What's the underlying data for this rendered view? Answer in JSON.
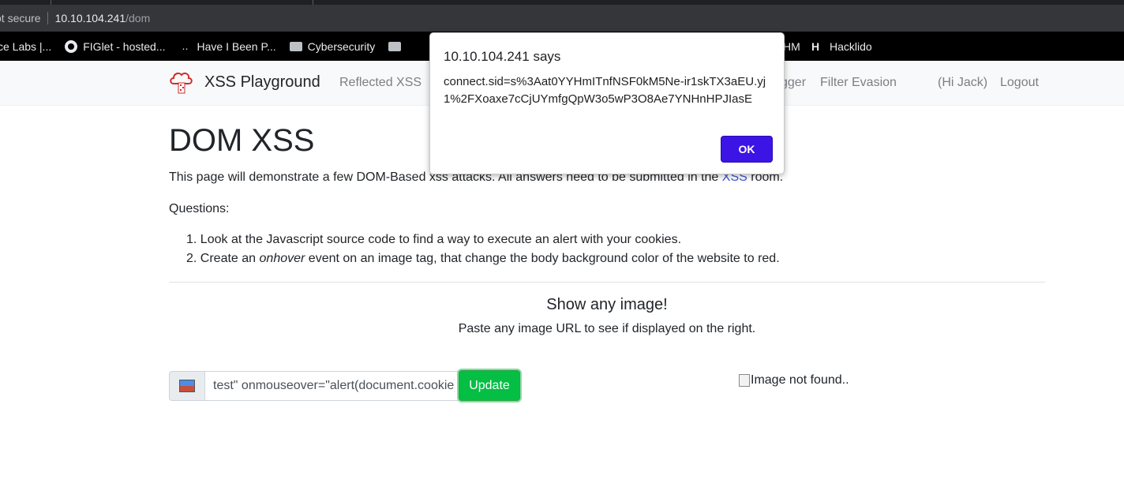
{
  "browser": {
    "security_label": "ot secure",
    "url_host": "10.10.104.241",
    "url_path": "/dom",
    "bookmarks": [
      {
        "label": "ce Labs |...",
        "icon": "none"
      },
      {
        "label": "FIGlet - hosted...",
        "icon": "globe-icon"
      },
      {
        "label": "Have I Been P...",
        "icon": "hibp-icon"
      },
      {
        "label": "Cybersecurity",
        "icon": "folder-icon"
      },
      {
        "label": "",
        "icon": "folder-icon"
      },
      {
        "label": "HM",
        "icon": "none"
      },
      {
        "label": "Hacklido",
        "icon": "h-icon"
      }
    ]
  },
  "navbar": {
    "brand": "XSS Playground",
    "links": {
      "reflected": "Reflected XSS",
      "logger": "gger",
      "filter": "Filter Evasion",
      "user": "(Hi Jack)",
      "logout": "Logout"
    }
  },
  "main": {
    "title": "DOM XSS",
    "intro_text": "This page will demonstrate a few DOM-Based xss attacks. All answers need to be submitted in the ",
    "intro_link": "XSS",
    "intro_suffix": " room.",
    "questions_label": "Questions:",
    "questions": [
      {
        "num": "1.",
        "text": "Look at the Javascript source code to find a way to execute an alert with your cookies."
      },
      {
        "num": "2.",
        "pre": "Create an ",
        "em": "onhover",
        "post": " event on an image tag, that change the body background color of the website to red."
      }
    ],
    "show_title": "Show any image!",
    "show_sub": "Paste any image URL to see if displayed on the right.",
    "input_value": "test\" onmouseover=\"alert(document.cookie)\"",
    "update_label": "Update",
    "image_alt": "Image not found.."
  },
  "dialog": {
    "title": "10.10.104.241 says",
    "message": "connect.sid=s%3Aat0YYHmITnfNSF0kM5Ne-ir1skTX3aEU.yj1%2FXoaxe7cCjUYmfgQpW3o5wP3O8Ae7YNHnHPJIasE",
    "ok_label": "OK"
  }
}
